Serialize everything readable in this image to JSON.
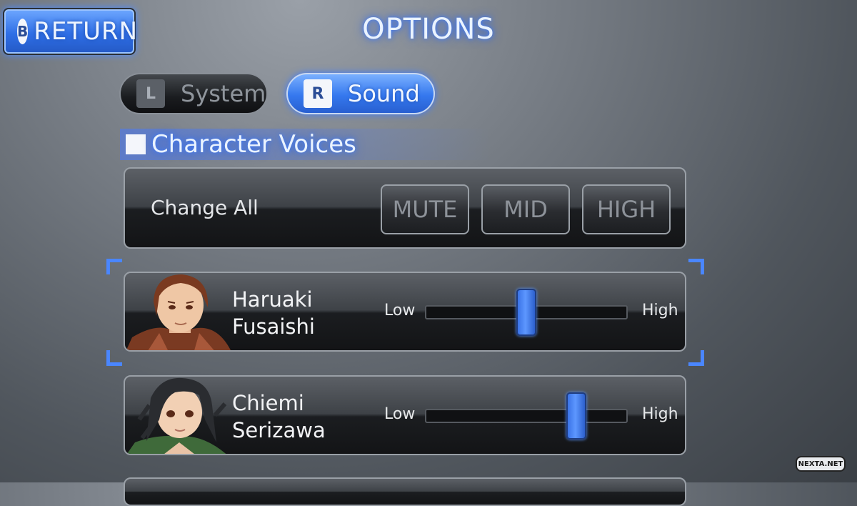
{
  "header": {
    "return_key": "B",
    "return_label": "RETURN",
    "title": "OPTIONS"
  },
  "tabs": [
    {
      "key": "L",
      "label": "System",
      "active": false
    },
    {
      "key": "R",
      "label": "Sound",
      "active": true
    }
  ],
  "section": {
    "label": "Character Voices"
  },
  "change_all": {
    "label": "Change All",
    "buttons": [
      "MUTE",
      "MID",
      "HIGH"
    ]
  },
  "characters": [
    {
      "name_line1": "Haruaki",
      "name_line2": "Fusaishi",
      "low_label": "Low",
      "high_label": "High",
      "volume": 0.5,
      "selected": true
    },
    {
      "name_line1": "Chiemi",
      "name_line2": "Serizawa",
      "low_label": "Low",
      "high_label": "High",
      "volume": 0.75,
      "selected": false
    }
  ],
  "colors": {
    "accent": "#3578ee",
    "glow": "#3d7bff",
    "panel_dark": "#1b1d20"
  },
  "watermark": "NEXTA.NET"
}
